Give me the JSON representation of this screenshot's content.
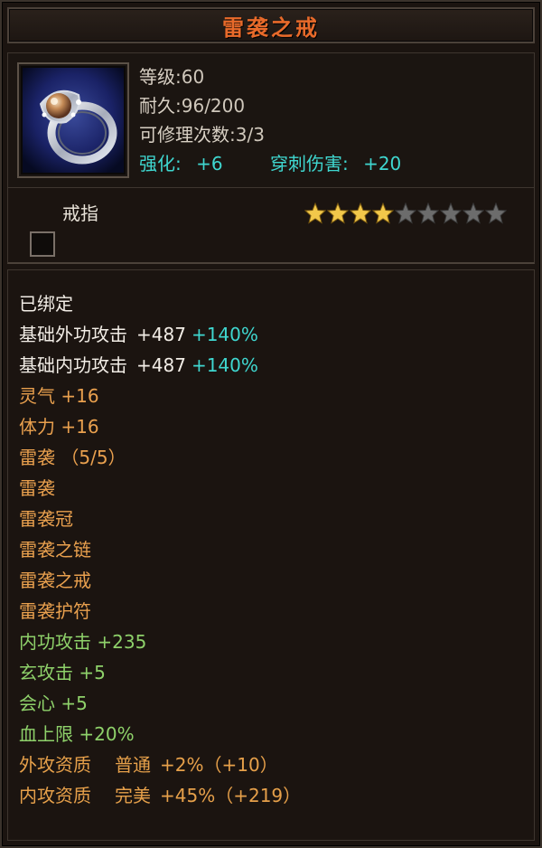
{
  "item": {
    "name": "雷袭之戒",
    "icon": "silver-pearl-ring-icon",
    "level_label": "等级",
    "level_value": ":60",
    "durability_label": "耐久",
    "durability_value": ":96/200",
    "repair_label": "可修理次数",
    "repair_value": ":3/3",
    "enhance_label": "强化:",
    "enhance_value": "+6",
    "pierce_label": "穿刺伤害:",
    "pierce_value": "+20",
    "type": "戒指",
    "stars": {
      "filled": 4,
      "total": 9
    }
  },
  "attributes": {
    "bound": "已绑定",
    "base_outer_attack": {
      "label": "基础外功攻击",
      "value": "+487",
      "bonus": "+140%"
    },
    "base_inner_attack": {
      "label": "基础内功攻击",
      "value": "+487",
      "bonus": "+140%"
    },
    "spirit": "灵气 +16",
    "stamina": "体力 +16",
    "set_name": "雷袭 （5/5）",
    "set_items": [
      "雷袭",
      "雷袭冠",
      "雷袭之链",
      "雷袭之戒",
      "雷袭护符"
    ],
    "inner_attack": "内功攻击 +235",
    "mystic_attack": "玄攻击 +5",
    "critical": "会心 +5",
    "hp_limit": "血上限 +20%",
    "outer_quality": {
      "label": "外攻资质",
      "grade": "普通",
      "value": "+2%（+10）"
    },
    "inner_quality": {
      "label": "内攻资质",
      "grade": "完美",
      "value": "+45%（+219）"
    }
  },
  "colors": {
    "title": "#e86a2a",
    "cyan": "#3fd7d0",
    "orange": "#e9a04e",
    "green": "#8ed16a",
    "star_gold": "#f2c84a",
    "star_grey": "#6c6c6c"
  }
}
